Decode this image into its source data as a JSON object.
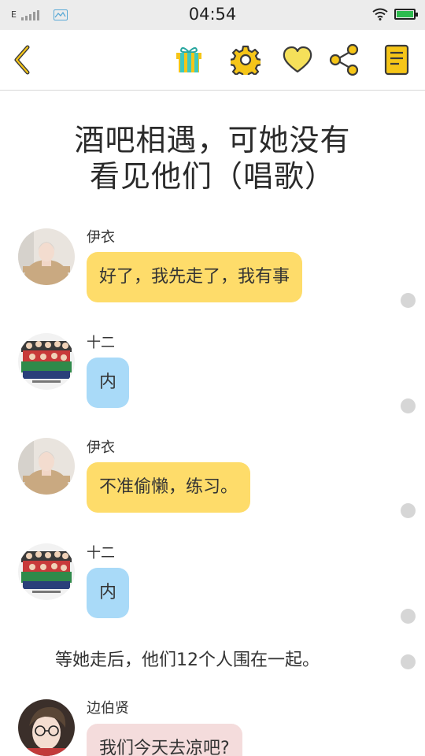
{
  "status_bar": {
    "network": "E",
    "time": "04:54"
  },
  "toolbar": {
    "icons": [
      "back-icon",
      "gift-icon",
      "gear-icon",
      "heart-icon",
      "share-icon",
      "book-icon"
    ],
    "accent": "#f5c518",
    "outline": "#3a3a3a"
  },
  "chapter": {
    "title_line1": "酒吧相遇，可她没有",
    "title_line2": "看见他们（唱歌）"
  },
  "messages": [
    {
      "sender": "伊衣",
      "text": "好了，我先走了，我有事",
      "color": "#fedc6a"
    },
    {
      "sender": "十二",
      "text": "内",
      "color": "#a9daf8"
    },
    {
      "sender": "伊衣",
      "text": "不准偷懒，练习。",
      "color": "#fedc6a"
    },
    {
      "sender": "十二",
      "text": "内",
      "color": "#a9daf8"
    },
    {
      "narration": "等她走后，他们12个人围在一起。"
    },
    {
      "sender": "边伯贤",
      "text": "我们今天去凉吧?",
      "color": "#f4dcdc"
    }
  ]
}
